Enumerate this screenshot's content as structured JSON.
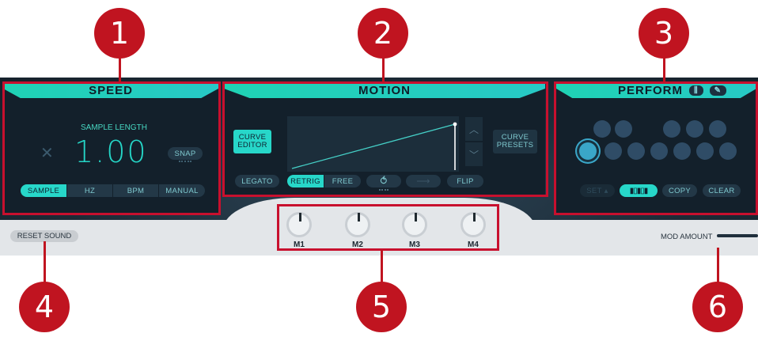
{
  "speed": {
    "title": "SPEED",
    "sample_length_label": "SAMPLE LENGTH",
    "value": "1.00",
    "snap_label": "SNAP",
    "modes": [
      "SAMPLE",
      "HZ",
      "BPM",
      "MANUAL"
    ],
    "active_mode": "SAMPLE"
  },
  "motion": {
    "title": "MOTION",
    "curve_editor_label": "CURVE\nEDITOR",
    "curve_presets_label": "CURVE\nPRESETS",
    "options": [
      "LEGATO",
      "RETRIG",
      "FREE",
      "FLIP"
    ],
    "active_option": "RETRIG"
  },
  "perform": {
    "title": "PERFORM",
    "set_label": "SET",
    "copy_label": "COPY",
    "clear_label": "CLEAR"
  },
  "footer": {
    "reset_label": "RESET SOUND",
    "mod_amount_label": "MOD AMOUNT"
  },
  "macros": [
    "M1",
    "M2",
    "M3",
    "M4"
  ],
  "callouts": [
    "1",
    "2",
    "3",
    "4",
    "5",
    "6"
  ],
  "colors": {
    "accent": "#27d7c9",
    "callout_red": "#c01420",
    "panel_bg": "#13202b"
  }
}
